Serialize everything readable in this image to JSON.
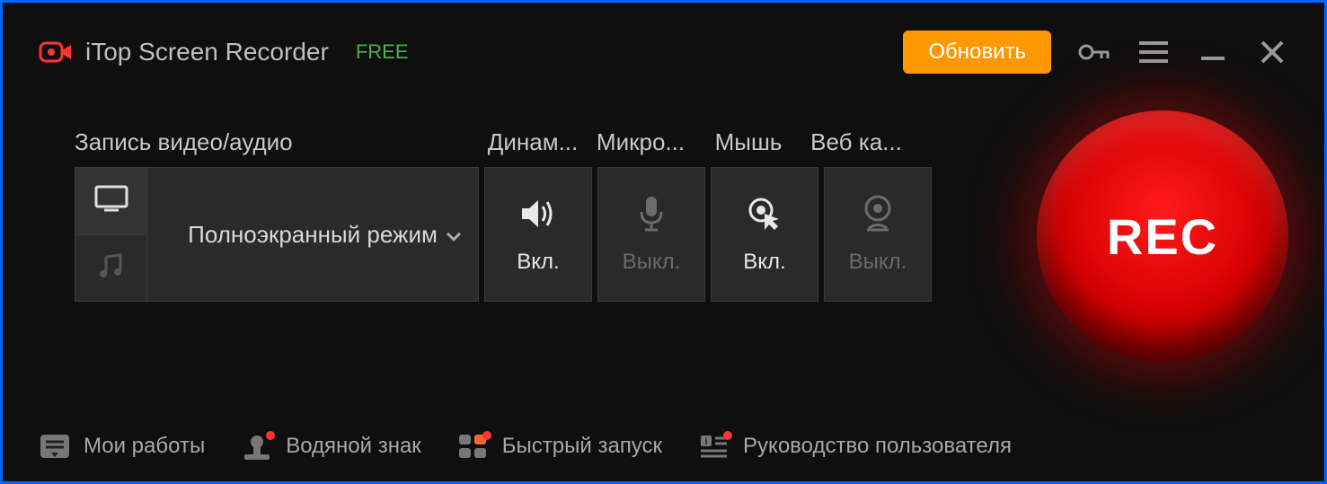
{
  "header": {
    "app_title": "iTop Screen Recorder",
    "free_badge": "FREE",
    "upgrade_label": "Обновить"
  },
  "capture": {
    "section_label": "Запись видео/аудио",
    "mode_label": "Полноэкранный режим",
    "toggles": [
      {
        "header": "Динам...",
        "state": "Вкл.",
        "on": true
      },
      {
        "header": "Микро...",
        "state": "Выкл.",
        "on": false
      },
      {
        "header": "Мышь",
        "state": "Вкл.",
        "on": true
      },
      {
        "header": "Веб ка...",
        "state": "Выкл.",
        "on": false
      }
    ]
  },
  "rec_label": "REC",
  "footer": [
    {
      "label": "Мои работы"
    },
    {
      "label": "Водяной знак"
    },
    {
      "label": "Быстрый запуск"
    },
    {
      "label": "Руководство пользователя"
    }
  ]
}
